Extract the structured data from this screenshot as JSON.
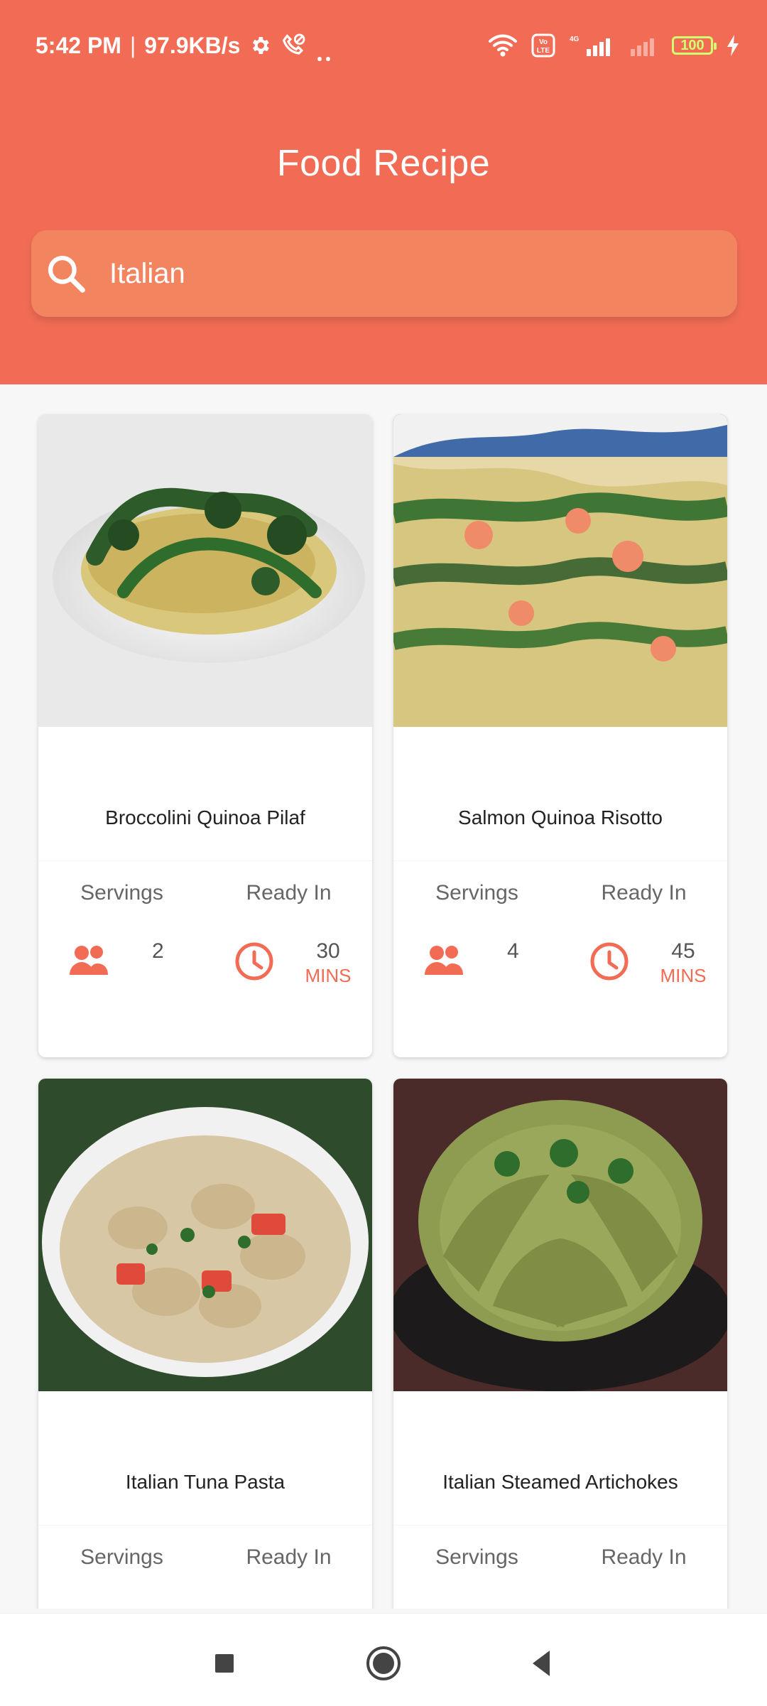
{
  "status_bar": {
    "time": "5:42 PM",
    "separator": "|",
    "net_speed": "97.9KB/s",
    "battery_level": "100"
  },
  "app": {
    "title": "Food Recipe"
  },
  "search": {
    "value": "Italian",
    "icon": "search-icon"
  },
  "recipes": [
    {
      "name": "Broccolini Quinoa Pilaf",
      "servings_label": "Servings",
      "servings": "2",
      "ready_label": "Ready In",
      "ready_value": "30",
      "ready_unit": "MINS"
    },
    {
      "name": "Salmon Quinoa Risotto",
      "servings_label": "Servings",
      "servings": "4",
      "ready_label": "Ready In",
      "ready_value": "45",
      "ready_unit": "MINS"
    },
    {
      "name": "Italian Tuna Pasta",
      "servings_label": "Servings",
      "servings": "",
      "ready_label": "Ready In",
      "ready_value": "",
      "ready_unit": ""
    },
    {
      "name": "Italian Steamed Artichokes",
      "servings_label": "Servings",
      "servings": "",
      "ready_label": "Ready In",
      "ready_value": "",
      "ready_unit": ""
    }
  ],
  "colors": {
    "header": "#f26c55",
    "search": "#f38460",
    "accent": "#f26c55"
  },
  "navbar": {
    "icons": [
      "recent-apps-icon",
      "home-icon",
      "back-icon"
    ]
  }
}
